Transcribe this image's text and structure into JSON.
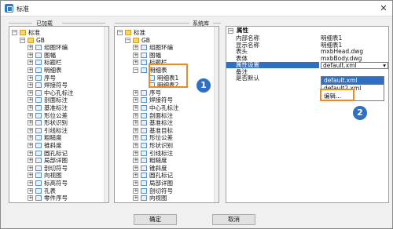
{
  "window": {
    "title": "标准",
    "close": "✕"
  },
  "groups": {
    "loaded": "已加载",
    "system": "系统库"
  },
  "left_tree": [
    {
      "label": "标准",
      "depth": 0,
      "exp": "−",
      "icon": "root"
    },
    {
      "label": "GB",
      "depth": 1,
      "exp": "−",
      "icon": "folder"
    },
    {
      "label": "组图环编",
      "depth": 2,
      "exp": "+"
    },
    {
      "label": "图幅",
      "depth": 2,
      "exp": "+"
    },
    {
      "label": "标题栏",
      "depth": 2,
      "exp": "+"
    },
    {
      "label": "明细表",
      "depth": 2,
      "exp": "+"
    },
    {
      "label": "序号",
      "depth": 2,
      "exp": "+"
    },
    {
      "label": "焊接符号",
      "depth": 2,
      "exp": "+"
    },
    {
      "label": "中心孔标注",
      "depth": 2,
      "exp": "+"
    },
    {
      "label": "剖面标注",
      "depth": 2,
      "exp": "+"
    },
    {
      "label": "基准标注",
      "depth": 2,
      "exp": "+"
    },
    {
      "label": "形位公差",
      "depth": 2,
      "exp": "+"
    },
    {
      "label": "形状识别",
      "depth": 2,
      "exp": "+"
    },
    {
      "label": "引线标注",
      "depth": 2,
      "exp": "+"
    },
    {
      "label": "粗糙度",
      "depth": 2,
      "exp": "+"
    },
    {
      "label": "锥斜度",
      "depth": 2,
      "exp": "+"
    },
    {
      "label": "圆孔标记",
      "depth": 2,
      "exp": "+"
    },
    {
      "label": "局部详图",
      "depth": 2,
      "exp": "+"
    },
    {
      "label": "剖切符号",
      "depth": 2,
      "exp": "+"
    },
    {
      "label": "向视图",
      "depth": 2,
      "exp": "+"
    },
    {
      "label": "标高符号",
      "depth": 2,
      "exp": "+"
    },
    {
      "label": "孔表",
      "depth": 2,
      "exp": "+"
    },
    {
      "label": "零件序号",
      "depth": 2,
      "exp": "+"
    }
  ],
  "mid_tree": [
    {
      "label": "标准",
      "depth": 0,
      "exp": "−",
      "icon": "root"
    },
    {
      "label": "GB",
      "depth": 1,
      "exp": "−",
      "icon": "folder"
    },
    {
      "label": "组图环编",
      "depth": 2,
      "exp": "+"
    },
    {
      "label": "图幅",
      "depth": 2,
      "exp": "+"
    },
    {
      "label": "标题栏",
      "depth": 2,
      "exp": "+"
    },
    {
      "label": "明细表",
      "depth": 2,
      "exp": "−"
    },
    {
      "label": "明细表1",
      "depth": 3,
      "exp": ""
    },
    {
      "label": "明细表2",
      "depth": 3,
      "exp": ""
    },
    {
      "label": "序号",
      "depth": 2,
      "exp": "+"
    },
    {
      "label": "焊接符号",
      "depth": 2,
      "exp": "+"
    },
    {
      "label": "中心孔标注",
      "depth": 2,
      "exp": "+"
    },
    {
      "label": "剖面标注",
      "depth": 2,
      "exp": "+"
    },
    {
      "label": "基准标注",
      "depth": 2,
      "exp": "+"
    },
    {
      "label": "基准目标",
      "depth": 2,
      "exp": "+"
    },
    {
      "label": "形位公差",
      "depth": 2,
      "exp": "+"
    },
    {
      "label": "形状识别",
      "depth": 2,
      "exp": "+"
    },
    {
      "label": "引线标注",
      "depth": 2,
      "exp": "+"
    },
    {
      "label": "粗糙度",
      "depth": 2,
      "exp": "+"
    },
    {
      "label": "锥斜度",
      "depth": 2,
      "exp": "+"
    },
    {
      "label": "圆孔标记",
      "depth": 2,
      "exp": "+"
    },
    {
      "label": "局部详图",
      "depth": 2,
      "exp": "+"
    },
    {
      "label": "剖切符号",
      "depth": 2,
      "exp": "+"
    },
    {
      "label": "向视图",
      "depth": 2,
      "exp": "+"
    },
    {
      "label": "标高符号",
      "depth": 2,
      "exp": "+"
    }
  ],
  "props": {
    "header": "属性",
    "rows": [
      {
        "k": "内部名称",
        "v": "明细表1"
      },
      {
        "k": "显示名称",
        "v": "明细表1"
      },
      {
        "k": "表头",
        "v": "mxbHead.dwg"
      },
      {
        "k": "表体",
        "v": "mxbBody.dwg"
      },
      {
        "k": "属性设置",
        "v": "default.xml",
        "sel": true
      },
      {
        "k": "备注",
        "v": ""
      },
      {
        "k": "是否默认",
        "v": ""
      }
    ],
    "dropdown": [
      "default.xml",
      "default2.xml",
      "编辑..."
    ],
    "arrow": "▾"
  },
  "callouts": [
    "1",
    "2"
  ],
  "buttons": {
    "ok": "确定",
    "cancel": "取消"
  }
}
